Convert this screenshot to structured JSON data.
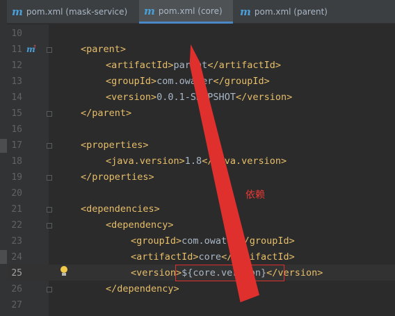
{
  "tabs": [
    {
      "icon": "m",
      "label": "pom.xml (mask-service)",
      "active": false
    },
    {
      "icon": "m",
      "label": "pom.xml (core)",
      "active": true
    },
    {
      "icon": "m",
      "label": "pom.xml (parent)",
      "active": false
    }
  ],
  "lines": [
    {
      "n": "10",
      "parts": []
    },
    {
      "n": "11",
      "parts": [
        {
          "t": "tag",
          "v": "<parent>"
        }
      ]
    },
    {
      "n": "12",
      "parts": [
        {
          "t": "tag",
          "v": "<artifactId>"
        },
        {
          "t": "txt",
          "v": "parent"
        },
        {
          "t": "tag",
          "v": "</artifactId>"
        }
      ]
    },
    {
      "n": "13",
      "parts": [
        {
          "t": "tag",
          "v": "<groupId>"
        },
        {
          "t": "txt",
          "v": "com.owater"
        },
        {
          "t": "tag",
          "v": "</groupId>"
        }
      ]
    },
    {
      "n": "14",
      "parts": [
        {
          "t": "tag",
          "v": "<version>"
        },
        {
          "t": "txt",
          "v": "0.0.1-SNAPSHOT"
        },
        {
          "t": "tag",
          "v": "</version>"
        }
      ]
    },
    {
      "n": "15",
      "parts": [
        {
          "t": "tag",
          "v": "</parent>"
        }
      ]
    },
    {
      "n": "16",
      "parts": []
    },
    {
      "n": "17",
      "parts": [
        {
          "t": "tag",
          "v": "<properties>"
        }
      ]
    },
    {
      "n": "18",
      "parts": [
        {
          "t": "tag",
          "v": "<java.version>"
        },
        {
          "t": "txt",
          "v": "1.8"
        },
        {
          "t": "tag",
          "v": "</java.version>"
        }
      ]
    },
    {
      "n": "19",
      "parts": [
        {
          "t": "tag",
          "v": "</properties>"
        }
      ]
    },
    {
      "n": "20",
      "parts": []
    },
    {
      "n": "21",
      "parts": [
        {
          "t": "tag",
          "v": "<dependencies>"
        }
      ]
    },
    {
      "n": "22",
      "parts": [
        {
          "t": "tag",
          "v": "<dependency>"
        }
      ]
    },
    {
      "n": "23",
      "parts": [
        {
          "t": "tag",
          "v": "<groupId>"
        },
        {
          "t": "txt",
          "v": "com.owater"
        },
        {
          "t": "tag",
          "v": "</groupId>"
        }
      ]
    },
    {
      "n": "24",
      "parts": [
        {
          "t": "tag",
          "v": "<artifactId>"
        },
        {
          "t": "txt",
          "v": "core"
        },
        {
          "t": "tag",
          "v": "</artifactId>"
        }
      ]
    },
    {
      "n": "25",
      "parts": [
        {
          "t": "tag",
          "v": "<version>"
        },
        {
          "t": "txt",
          "v": "${core.version}"
        },
        {
          "t": "tag",
          "v": "</version>"
        }
      ]
    },
    {
      "n": "26",
      "parts": [
        {
          "t": "tag",
          "v": "</dependency>"
        }
      ]
    },
    {
      "n": "27",
      "parts": []
    }
  ],
  "current_line": "25",
  "annotation": {
    "text": "依赖",
    "color": "#e83a35"
  },
  "colors": {
    "tag": "#e8bf6a",
    "text": "#a9b7c6",
    "line_number": "#606366",
    "accent": "#4a88c7"
  },
  "icons": {
    "maven": "maven-m-icon",
    "gutter_marker": "maven-gutter-up-arrow-icon",
    "intention": "lightbulb-icon"
  }
}
